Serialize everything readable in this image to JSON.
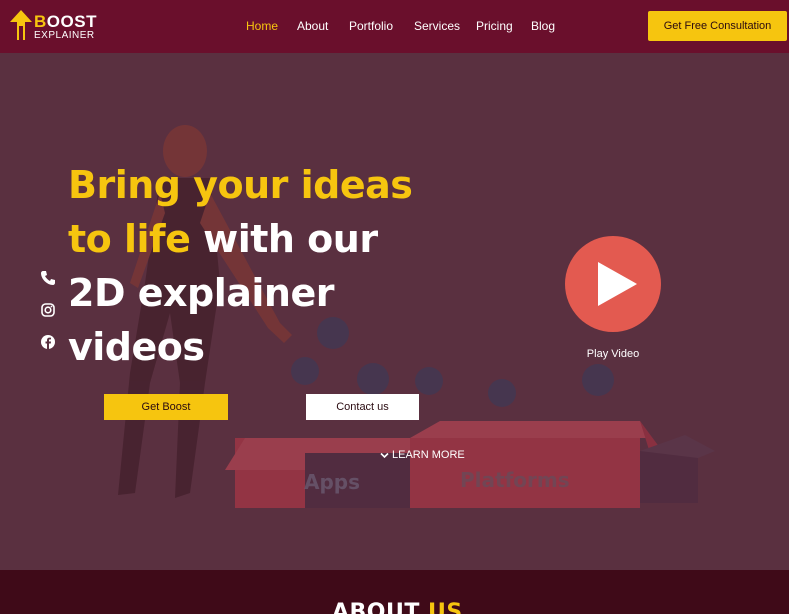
{
  "header": {
    "logo": {
      "line1_highlight": "B",
      "line1_rest": "OOST",
      "line2": "EXPLAINER"
    },
    "nav": [
      {
        "label": "Home",
        "active": true
      },
      {
        "label": "About",
        "active": false
      },
      {
        "label": "Portfolio",
        "active": false
      },
      {
        "label": "Services",
        "active": false
      },
      {
        "label": "Pricing",
        "active": false
      },
      {
        "label": "Blog",
        "active": false
      }
    ],
    "cta_label": "Get Free Consultation"
  },
  "hero": {
    "headline": {
      "line1": "Bring your ideas",
      "line2_highlight": "to life",
      "line2_rest": " with our",
      "line3": "2D explainer",
      "line4": "videos"
    },
    "primary_button": "Get Boost",
    "secondary_button": "Contact us",
    "learn_more": "LEARN MORE",
    "play_label": "Play Video",
    "illustration_labels": {
      "apps": "Apps",
      "platforms": "Platforms"
    },
    "social_icons": [
      "phone-icon",
      "instagram-icon",
      "facebook-icon"
    ]
  },
  "about": {
    "title_white": "ABOUT",
    "title_highlight": "US"
  },
  "colors": {
    "header_bg": "#6a0f2c",
    "accent": "#f6c50f",
    "hero_overlay": "#5a3040",
    "play_button": "#e35a50",
    "about_bg": "#3f0a18"
  }
}
